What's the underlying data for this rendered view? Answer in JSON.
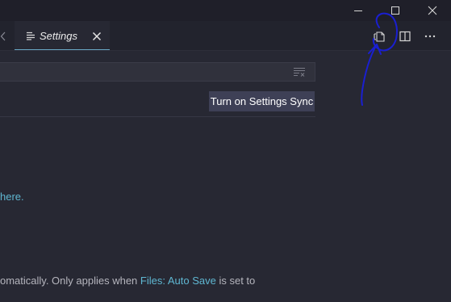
{
  "window_controls": {
    "minimize_icon": "minimize-icon",
    "maximize_icon": "maximize-icon",
    "close_icon": "close-icon"
  },
  "tab": {
    "label": "Settings",
    "icon": "settings-list-icon",
    "close_icon": "close-icon"
  },
  "editor_actions": {
    "open_json_icon": "open-settings-json-icon",
    "split_icon": "split-editor-icon",
    "more_icon": "more-actions-icon"
  },
  "search": {
    "value": "",
    "clear_icon": "clear-filter-icon"
  },
  "sync_button": {
    "label": "Turn on Settings Sync"
  },
  "content": {
    "link_fragment": "here.",
    "description_prefix": "omatically. Only applies when ",
    "description_keyword": "Files: Auto Save",
    "description_suffix": " is set to"
  },
  "colors": {
    "background": "#272833",
    "titlebar": "#1f1f29",
    "accent_link": "#5fb7d2",
    "button": "#3e4056",
    "annotation_ink": "#1a1fd1"
  }
}
